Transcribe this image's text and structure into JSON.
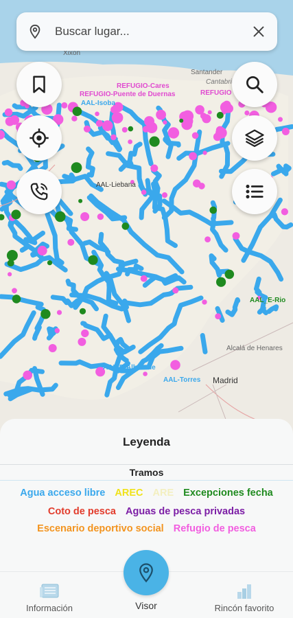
{
  "search": {
    "placeholder": "Buscar lugar..."
  },
  "map": {
    "place_labels": [
      "Xixon",
      "Santander",
      "Cantabria",
      "Alcalá de Henares",
      "Madrid"
    ],
    "feature_labels": [
      "REFUGIO-Cares",
      "REFUGIO-Puente de Duernas",
      "AAL-Isoba",
      "REFUGIO",
      "AAL-Liebana",
      "AAL_E-Rio",
      "AAL-E-Alberche",
      "AAL-Torres"
    ],
    "colors": {
      "water": "#3aa8ec",
      "refugio": "#f25ee0",
      "excepciones": "#1f8a1f",
      "arec": "#f0e21a",
      "land": "#eeebe4",
      "sea": "#a9d3ea"
    }
  },
  "fab_icons": {
    "bookmark": "bookmark-icon",
    "locate": "crosshair-icon",
    "call": "phone-icon",
    "search": "search-icon",
    "layers": "layers-icon",
    "list": "list-icon"
  },
  "legend": {
    "title": "Leyenda",
    "subtitle": "Tramos",
    "rows": [
      [
        {
          "label": "Agua acceso libre",
          "color": "#3aa8ec"
        },
        {
          "label": "AREC",
          "color": "#f0e21a"
        },
        {
          "label": "ARE",
          "color": "#f3efc0"
        },
        {
          "label": "Excepciones fecha",
          "color": "#1f8a1f"
        }
      ],
      [
        {
          "label": "Coto de pesca",
          "color": "#e23c2c"
        },
        {
          "label": "Aguas de pesca privadas",
          "color": "#7d1fa6"
        }
      ],
      [
        {
          "label": "Escenario deportivo social",
          "color": "#f3941f"
        },
        {
          "label": "Refugio de pesca",
          "color": "#f25ee0"
        }
      ]
    ]
  },
  "nav": {
    "informacion": "Información",
    "visor": "Visor",
    "rincon": "Rincón favorito",
    "accent": "#4ab3e6"
  }
}
